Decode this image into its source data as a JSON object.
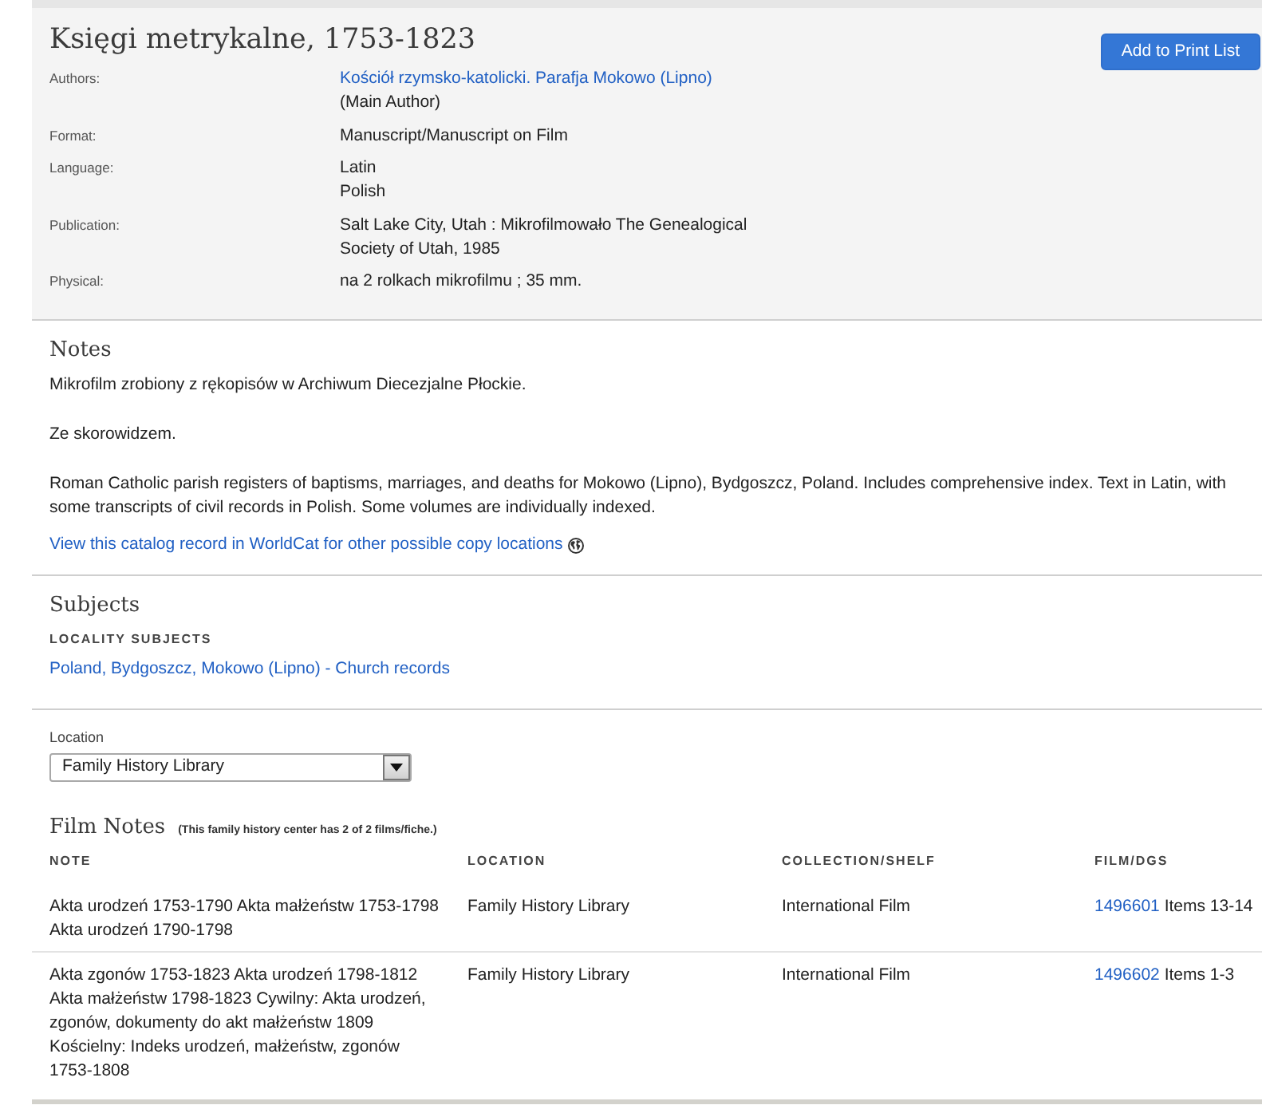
{
  "record": {
    "title": "Księgi metrykalne, 1753-1823",
    "print_button": "Add to Print List",
    "fields": [
      {
        "label": "Authors:",
        "values": [
          {
            "kind": "link",
            "text": "Kościół rzymsko-katolicki. Parafja Mokowo (Lipno)"
          },
          {
            "kind": "text",
            "text": "(Main Author)"
          }
        ]
      },
      {
        "label": "Format:",
        "values": [
          {
            "kind": "text",
            "text": "Manuscript/Manuscript on Film"
          }
        ]
      },
      {
        "label": "Language:",
        "values": [
          {
            "kind": "text",
            "text": "Latin"
          },
          {
            "kind": "text",
            "text": "Polish"
          }
        ]
      },
      {
        "label": "Publication:",
        "values": [
          {
            "kind": "text",
            "text": "Salt Lake City, Utah : Mikrofilmowało The Genealogical Society of Utah, 1985"
          }
        ]
      },
      {
        "label": "Physical:",
        "values": [
          {
            "kind": "text",
            "text": "na 2 rolkach mikrofilmu ; 35 mm."
          }
        ]
      }
    ]
  },
  "notes": {
    "heading": "Notes",
    "paragraphs": [
      "Mikrofilm zrobiony z rękopisów w Archiwum Diecezjalne Płockie.",
      "Ze skorowidzem.",
      "Roman Catholic parish registers of baptisms, marriages, and deaths for Mokowo (Lipno), Bydgoszcz, Poland. Includes comprehensive index. Text in Latin, with some transcripts of civil records in Polish. Some volumes are individually indexed."
    ],
    "worldcat_link": "View this catalog record in WorldCat for other possible copy locations"
  },
  "subjects": {
    "heading": "Subjects",
    "groups": [
      {
        "heading": "LOCALITY SUBJECTS",
        "links": [
          "Poland, Bydgoszcz, Mokowo (Lipno) - Church records"
        ]
      }
    ]
  },
  "location": {
    "label": "Location",
    "value": "Family History Library"
  },
  "film_notes": {
    "heading": "Film Notes",
    "summary": "(This family history center has 2 of 2 films/fiche.)",
    "columns": [
      "NOTE",
      "LOCATION",
      "COLLECTION/SHELF",
      "FILM/DGS"
    ],
    "rows": [
      {
        "note": "Akta urodzeń 1753-1790 Akta małżeństw 1753-1798 Akta urodzeń 1790-1798",
        "location": "Family History Library",
        "collection": "International Film",
        "film": "1496601",
        "items": "Items 13-14"
      },
      {
        "note": "Akta zgonów 1753-1823 Akta urodzeń 1798-1812 Akta małżeństw 1798-1823 Cywilny: Akta urodzeń, zgonów, dokumenty do akt małżeństw 1809 Kościelny: Indeks urodzeń, małżeństw, zgonów 1753-1808",
        "location": "Family History Library",
        "collection": "International Film",
        "film": "1496602",
        "items": "Items 1-3"
      }
    ]
  }
}
